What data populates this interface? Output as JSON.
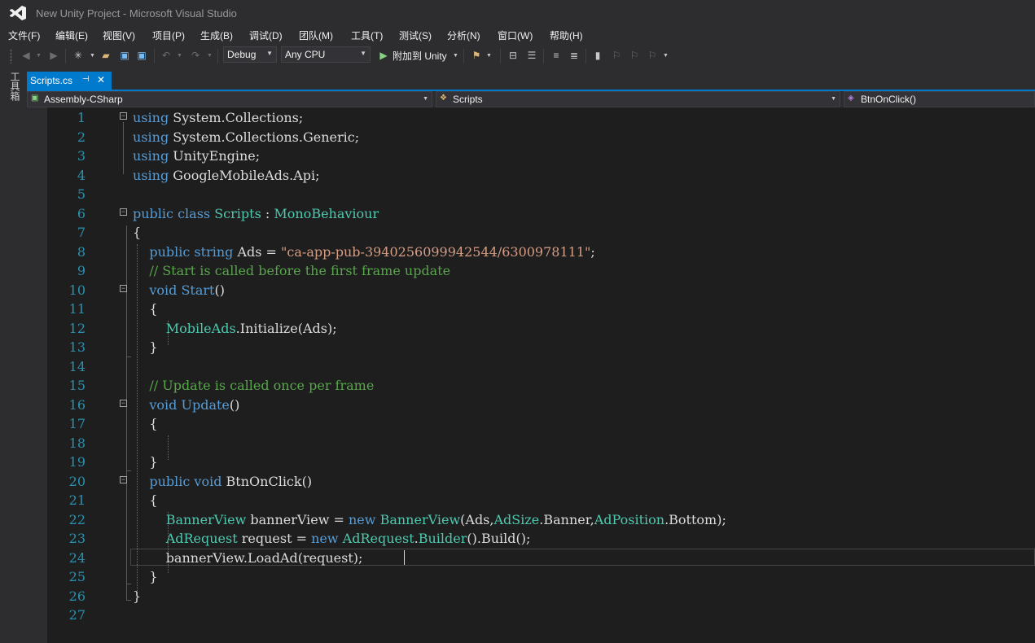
{
  "window": {
    "title": "New Unity Project - Microsoft Visual Studio"
  },
  "menu": [
    "文件(F)",
    "编辑(E)",
    "视图(V)",
    "项目(P)",
    "生成(B)",
    "调试(D)",
    "团队(M)",
    "工具(T)",
    "测试(S)",
    "分析(N)",
    "窗口(W)",
    "帮助(H)"
  ],
  "toolbar": {
    "config": "Debug",
    "platform": "Any CPU",
    "attach_label": "附加到 Unity"
  },
  "side_panel": {
    "toolbox_label": "工具箱"
  },
  "tab": {
    "label": "Scripts.cs",
    "pin": "⊣",
    "close": "✕"
  },
  "navbar": {
    "project": "Assembly-CSharp",
    "class": "Scripts",
    "member": "BtnOnClick()"
  },
  "editor": {
    "line_numbers": [
      "1",
      "2",
      "3",
      "4",
      "5",
      "6",
      "7",
      "8",
      "9",
      "10",
      "11",
      "12",
      "13",
      "14",
      "15",
      "16",
      "17",
      "18",
      "19",
      "20",
      "21",
      "22",
      "23",
      "24",
      "25",
      "26",
      "27"
    ],
    "code_lines": [
      "using System.Collections;",
      "using System.Collections.Generic;",
      "using UnityEngine;",
      "using GoogleMobileAds.Api;",
      "",
      "public class Scripts : MonoBehaviour",
      "{",
      "    public string Ads = \"ca-app-pub-3940256099942544/6300978111\";",
      "    // Start is called before the first frame update",
      "    void Start()",
      "    {",
      "        MobileAds.Initialize(Ads);",
      "    }",
      "",
      "    // Update is called once per frame",
      "    void Update()",
      "    {",
      "",
      "    }",
      "    public void BtnOnClick()",
      "    {",
      "        BannerView bannerView = new BannerView(Ads,AdSize.Banner,AdPosition.Bottom);",
      "        AdRequest request = new AdRequest.Builder().Build();",
      "        bannerView.LoadAd(request);",
      "    }",
      "}",
      ""
    ],
    "current_line": 24
  },
  "colors": {
    "accent": "#007acc",
    "keyword": "#569cd6",
    "type": "#4ec9b0",
    "string": "#d69d85",
    "comment": "#57a64a"
  }
}
